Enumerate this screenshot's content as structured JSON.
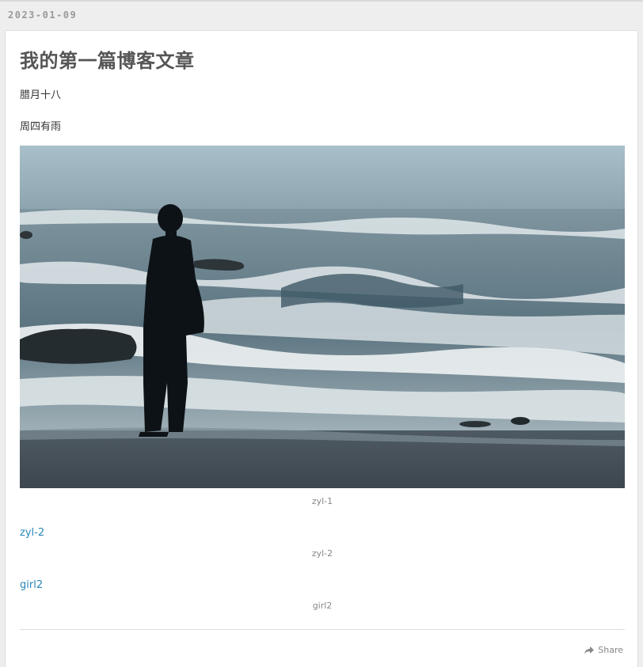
{
  "post": {
    "date": "2023-01-09",
    "title": "我的第一篇博客文章",
    "paragraphs": [
      "腊月十八",
      "周四有雨"
    ]
  },
  "figures": [
    {
      "caption": "zyl-1"
    },
    {
      "link_text": "zyl-2",
      "caption": "zyl-2"
    },
    {
      "link_text": "girl2",
      "caption": "girl2"
    }
  ],
  "footer": {
    "share_label": "Share",
    "share_icon": "share-icon"
  },
  "colors": {
    "link": "#2a87b8",
    "title": "#555555",
    "caption": "#888888",
    "background": "#eeeeee"
  }
}
